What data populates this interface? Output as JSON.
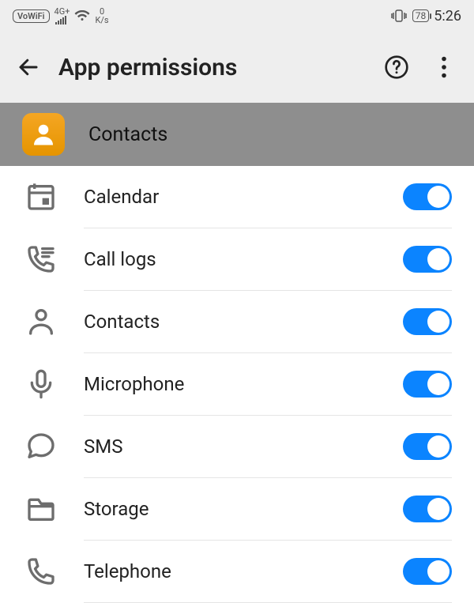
{
  "status": {
    "wifi_calling": "VoWiFi",
    "signal_label": "4G+",
    "net_speed_top": "0",
    "net_speed_bottom": "K/s",
    "vibrate_icon": "}[]{",
    "battery": "78",
    "time": "5:26"
  },
  "appbar": {
    "title": "App permissions"
  },
  "app_header": {
    "name": "Contacts"
  },
  "permissions": [
    {
      "label": "Calendar",
      "enabled": true
    },
    {
      "label": "Call logs",
      "enabled": true
    },
    {
      "label": "Contacts",
      "enabled": true
    },
    {
      "label": "Microphone",
      "enabled": true
    },
    {
      "label": "SMS",
      "enabled": true
    },
    {
      "label": "Storage",
      "enabled": true
    },
    {
      "label": "Telephone",
      "enabled": true
    }
  ]
}
